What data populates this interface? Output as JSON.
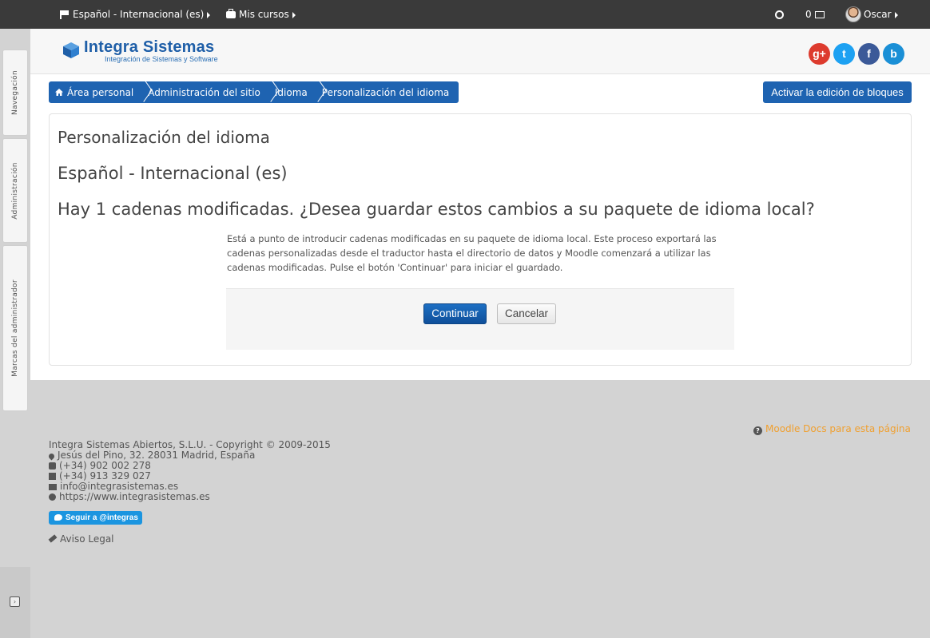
{
  "dock": {
    "tabs": [
      "Navegación",
      "Administración",
      "Marcas del administrador"
    ]
  },
  "navbar": {
    "language": "Español - Internacional (es)",
    "courses": "Mis cursos",
    "messages_count": "0",
    "user": "Oscar"
  },
  "header": {
    "logo_title": "Integra Sistemas",
    "logo_subtitle": "Integración de Sistemas y Software",
    "social": [
      "google-plus-icon",
      "twitter-icon",
      "facebook-icon",
      "blog-icon"
    ]
  },
  "breadcrumb": {
    "items": [
      "Área personal",
      "Administración del sitio",
      "Idioma",
      "Personalización del idioma"
    ]
  },
  "edit_blocks_label": "Activar la edición de bloques",
  "content": {
    "title": "Personalización del idioma",
    "language": "Español - Internacional (es)",
    "question": "Hay 1 cadenas modificadas. ¿Desea guardar estos cambios a su paquete de idioma local?",
    "notice": "Está a punto de introducir cadenas modificadas en su paquete de idioma local. Este proceso exportará las cadenas personalizadas desde el traductor hasta el directorio de datos y Moodle comenzará a utilizar las cadenas modificadas. Pulse el botón 'Continuar' para iniciar el guardado.",
    "continue_label": "Continuar",
    "cancel_label": "Cancelar"
  },
  "footer": {
    "docs_link": "Moodle Docs para esta página",
    "company": "Integra Sistemas Abiertos, S.L.U.",
    "copyright": " - Copyright © 2009-2015",
    "address": "Jesús del Pino, 32. 28031 Madrid, España",
    "phone": "(+34) 902 002 278",
    "fax": "(+34) 913 329 027",
    "email": "info@integrasistemas.es",
    "website": "https://www.integrasistemas.es",
    "twitter_label": "Seguir a @integras",
    "legal": "Aviso Legal"
  },
  "colors": {
    "accent": "#1e63b1",
    "navbar": "#3a3a3a",
    "docs_link": "#f0a030",
    "google": "#dd3b2e",
    "twitter": "#1da1f2",
    "facebook": "#3b5998",
    "blog": "#1a8fd6"
  }
}
